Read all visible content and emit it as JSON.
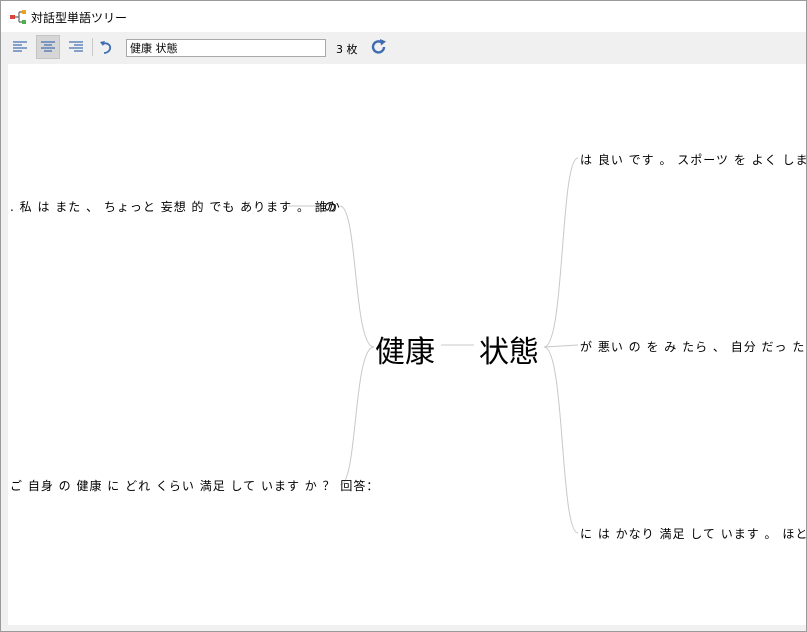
{
  "window": {
    "title": "対話型単語ツリー"
  },
  "toolbar": {
    "align_left_icon": "align-left-icon",
    "align_center_icon": "align-center-icon",
    "align_right_icon": "align-right-icon",
    "undo_icon": "undo-icon",
    "refresh_icon": "refresh-icon",
    "search_value": "健康 状態",
    "count": "3 枚"
  },
  "tree": {
    "left_root": "健康",
    "right_root": "状態",
    "left_branches": [
      {
        "text": ". 私 は また 、 ちょっと 妄想 的 でも あります 。 誰か",
        "connector": "の"
      },
      {
        "text": "ご 自身 の 健康 に どれ くらい 満足 して います か ？ 回答：",
        "connector": ""
      }
    ],
    "right_branches": [
      {
        "text": "は 良い です 。 スポーツ を よく します し 、"
      },
      {
        "text": "が 悪い の を み たら 、 自分 だっ たら どう か"
      },
      {
        "text": "に は かなり 満足 して います 。 ほとんど 病"
      }
    ]
  },
  "colors": {
    "branch_line": "#c8c8c8",
    "icon_blue": "#3d6cb0",
    "active_button": "#d6d6d6"
  }
}
